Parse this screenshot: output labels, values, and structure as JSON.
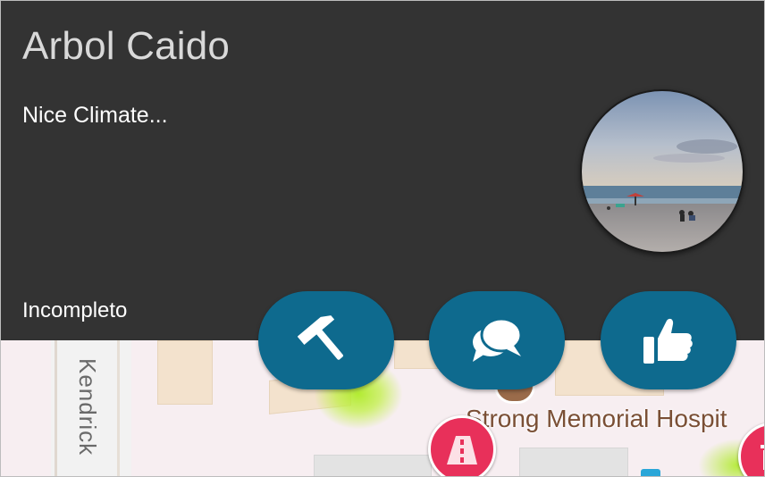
{
  "report": {
    "title": "Arbol Caido",
    "description": "Nice Climate...",
    "status": "Incompleto",
    "photo": "beach-photo"
  },
  "actions": [
    {
      "icon": "hammer-icon"
    },
    {
      "icon": "comments-icon"
    },
    {
      "icon": "thumbs-up-icon"
    }
  ],
  "map": {
    "street_label": "Kendrick",
    "place_label": "Strong Memorial Hospit",
    "marker_color": "#e8305a",
    "heat_color": "#b4eb2a"
  },
  "colors": {
    "card_background": "#333333",
    "accent": "#0e6a8e",
    "title_text": "#d9d9d9"
  }
}
